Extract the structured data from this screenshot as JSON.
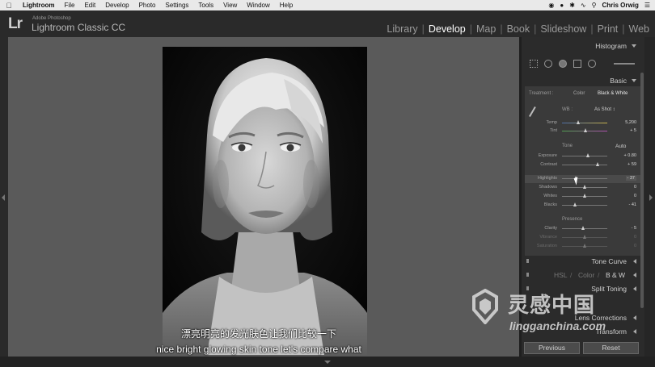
{
  "menubar": {
    "app": "Lightroom",
    "items": [
      "File",
      "Edit",
      "Develop",
      "Photo",
      "Settings",
      "Tools",
      "View",
      "Window",
      "Help"
    ],
    "user": "Chris Orwig"
  },
  "identity": {
    "small": "Adobe Photoshop",
    "name": "Lightroom Classic CC",
    "logo": "Lr"
  },
  "modules": [
    {
      "label": "Library"
    },
    {
      "label": "Develop"
    },
    {
      "label": "Map"
    },
    {
      "label": "Book"
    },
    {
      "label": "Slideshow"
    },
    {
      "label": "Print"
    },
    {
      "label": "Web"
    }
  ],
  "active_module": "Develop",
  "panel": {
    "histogram": "Histogram",
    "basic": "Basic",
    "treatment_label": "Treatment :",
    "treatment_color": "Color",
    "treatment_bw": "Black & White",
    "wb_label": "WB :",
    "wb_value": "As Shot ↕",
    "tone": "Tone",
    "auto": "Auto",
    "presence": "Presence",
    "tone_curve": "Tone Curve",
    "hsl": "HSL",
    "color": "Color",
    "bw": "B & W",
    "split_toning": "Split Toning",
    "lens_corrections": "Lens Corrections",
    "transform": "Transform",
    "previous": "Previous",
    "reset": "Reset"
  },
  "sliders": {
    "temp": {
      "label": "Temp",
      "value": "5,200",
      "pos": 0.36
    },
    "tint": {
      "label": "Tint",
      "value": "+ 5",
      "pos": 0.52
    },
    "exposure": {
      "label": "Exposure",
      "value": "+ 0.80",
      "pos": 0.58
    },
    "contrast": {
      "label": "Contrast",
      "value": "+ 59",
      "pos": 0.8
    },
    "highlights": {
      "label": "Highlights",
      "value": "- 37",
      "pos": 0.32
    },
    "shadows": {
      "label": "Shadows",
      "value": "0",
      "pos": 0.5
    },
    "whites": {
      "label": "Whites",
      "value": "0",
      "pos": 0.5
    },
    "blacks": {
      "label": "Blacks",
      "value": "- 41",
      "pos": 0.3
    },
    "clarity": {
      "label": "Clarity",
      "value": "- 5",
      "pos": 0.47
    },
    "vibrance": {
      "label": "Vibrance",
      "value": "0",
      "pos": 0.5
    },
    "saturation": {
      "label": "Saturation",
      "value": "0",
      "pos": 0.5
    }
  },
  "subtitles": {
    "zh": "漂亮明亮的发光肤色让我们比较一下",
    "en": "nice bright glowing skin tone let's compare what"
  },
  "watermark": {
    "cn": "灵感中国",
    "en": "lingganchina.com"
  }
}
